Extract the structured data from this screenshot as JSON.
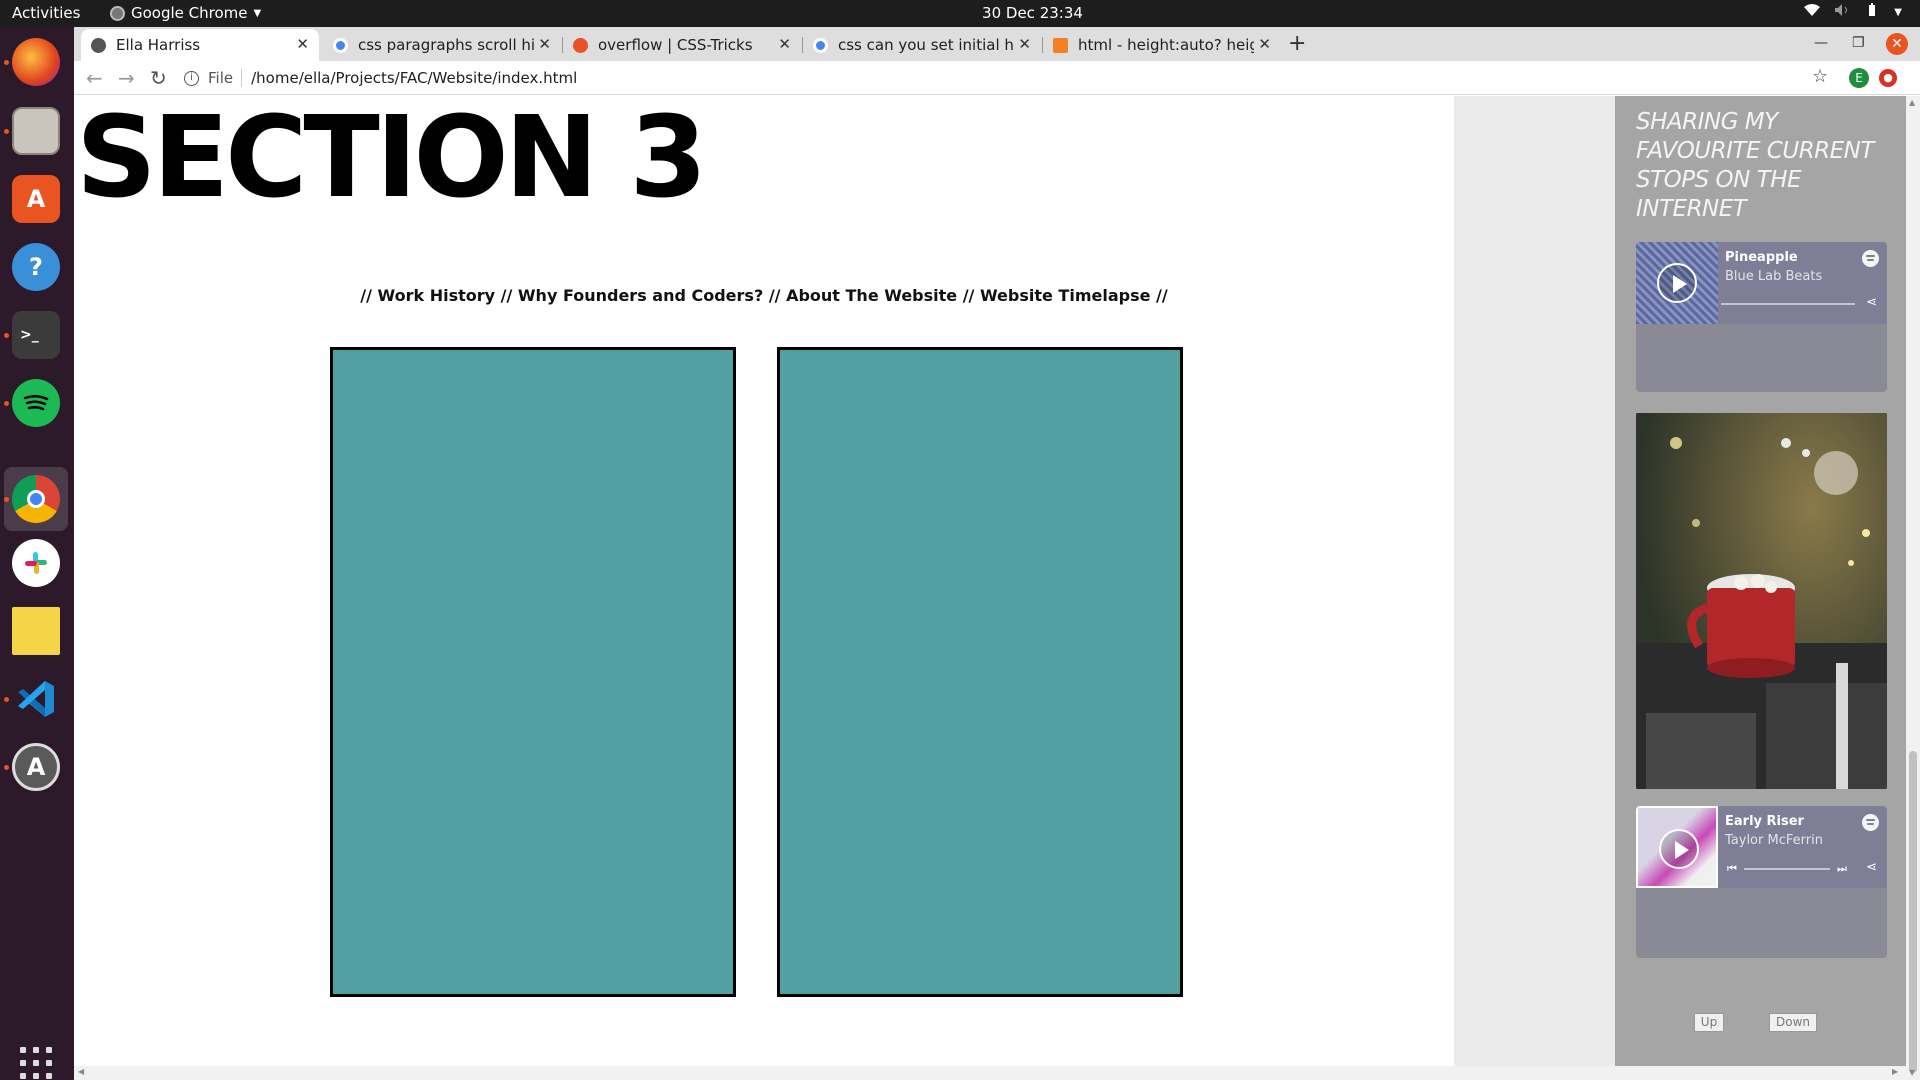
{
  "os": {
    "activities": "Activities",
    "app_menu": "Google Chrome",
    "clock": "30 Dec  23:34"
  },
  "dock": {
    "items": [
      "firefox-icon",
      "files-icon",
      "software-icon",
      "help-icon",
      "terminal-icon",
      "spotify-icon",
      "chrome-icon",
      "slack-icon",
      "notes-icon",
      "vscode-icon",
      "updater-icon"
    ],
    "show_apps": "show-applications-icon"
  },
  "browser": {
    "tabs": [
      {
        "title": "Ella Harriss",
        "active": true,
        "favicon_color": "#555555"
      },
      {
        "title": "css paragraphs scroll hidden",
        "active": false,
        "favicon_color": "#4285f4"
      },
      {
        "title": "overflow | CSS-Tricks",
        "active": false,
        "favicon_color": "#e8512a"
      },
      {
        "title": "css can you set initial height",
        "active": false,
        "favicon_color": "#4285f4"
      },
      {
        "title": "html - height:auto? height",
        "active": false,
        "favicon_color": "#f48024"
      }
    ],
    "address": {
      "scheme": "File",
      "url": "/home/ella/Projects/FAC/Website/index.html"
    },
    "profile_initial": "E"
  },
  "page": {
    "section_title": "SECTION 3",
    "nav_links": [
      "// Work History",
      "// Why Founders and Coders?",
      "// About The Website",
      "// Website Timelapse //"
    ],
    "card_color": "#52a0a1",
    "sidebar": {
      "heading": "SHARING MY FAVOURITE CURRENT STOPS ON THE INTERNET",
      "embeds": [
        {
          "track": "Pineapple",
          "artist": "Blue Lab Beats"
        },
        {
          "track": "Early Riser",
          "artist": "Taylor McFerrin"
        }
      ],
      "up_label": "Up",
      "down_label": "Down"
    }
  }
}
